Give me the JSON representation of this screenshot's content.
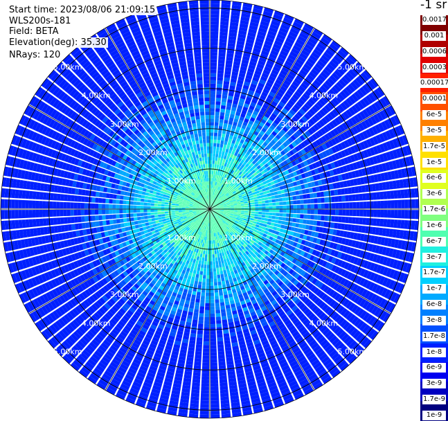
{
  "header": {
    "start_time": "Start time: 2023/08/06 21:09:15",
    "instrument": "WLS200s-181",
    "field": "Field: BETA",
    "elevation": "Elevation(deg): 35.30",
    "nrays": "NRays: 120"
  },
  "colorbar": {
    "unit": "-1 sr",
    "ticks": [
      "0.0017",
      "0.001",
      "0.0006",
      "0.0003",
      "0.00017",
      "0.0001",
      "6e-5",
      "3e-5",
      "1.7e-5",
      "1e-5",
      "6e-6",
      "3e-6",
      "1.7e-6",
      "1e-6",
      "6e-7",
      "3e-7",
      "1.7e-7",
      "1e-7",
      "6e-8",
      "3e-8",
      "1.7e-8",
      "1e-8",
      "6e-9",
      "3e-9",
      "1.7e-9",
      "1e-9"
    ]
  },
  "chart_data": {
    "type": "heatmap",
    "projection": "polar PPI",
    "field": "BETA",
    "elevation_deg": 35.3,
    "n_rays": 120,
    "range_rings_km": [
      "1.00km",
      "2.00km",
      "3.00km",
      "4.00km",
      "5.00km"
    ],
    "max_range_km": 5.2,
    "colors": [
      "#000080",
      "#0000c0",
      "#0000f0",
      "#0020ff",
      "#0050ff",
      "#0080ff",
      "#00aaff",
      "#00d0ff",
      "#20f0e0",
      "#50ffb0",
      "#80ff80",
      "#b0ff50",
      "#e0ff20",
      "#ffe000",
      "#ffb000",
      "#ff8000",
      "#ff5000",
      "#ff2000",
      "#e00000",
      "#b00000",
      "#800000"
    ],
    "range_profile_example": [
      {
        "range_km": 0.5,
        "beta": "1.7e-7"
      },
      {
        "range_km": 1.0,
        "beta": "1e-7"
      },
      {
        "range_km": 2.0,
        "beta": "3e-8"
      },
      {
        "range_km": 3.0,
        "beta": "1.7e-8"
      },
      {
        "range_km": 5.0,
        "beta": "6e-9"
      }
    ]
  }
}
